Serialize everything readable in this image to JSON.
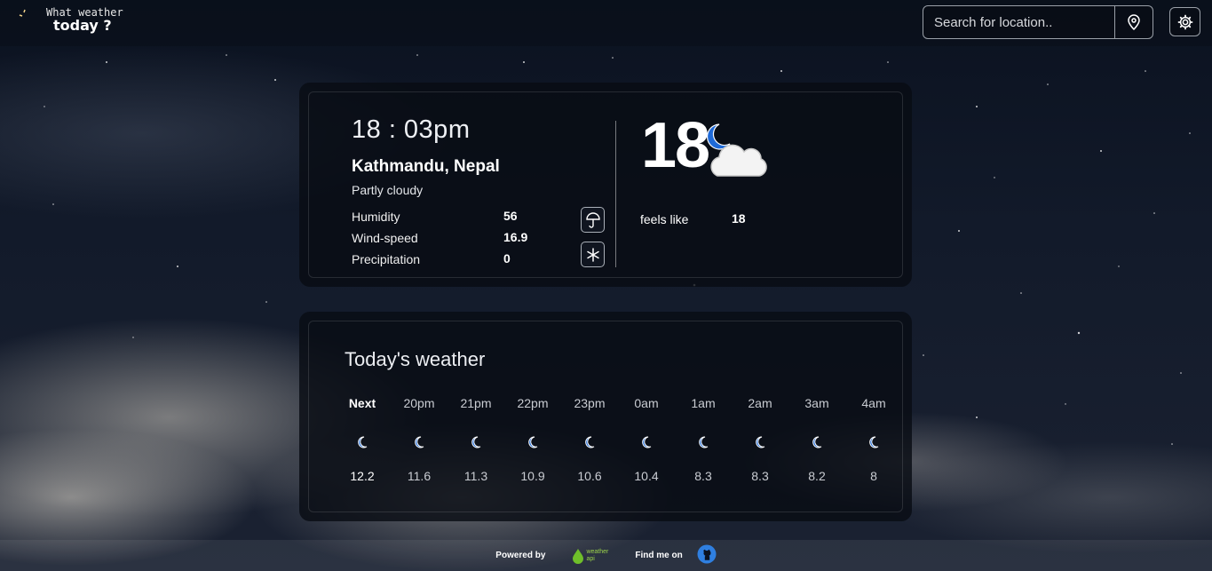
{
  "app": {
    "logo_line1": "What weather",
    "logo_line2": "today ?"
  },
  "search": {
    "placeholder": "Search for location.."
  },
  "current": {
    "time": "18 : 03pm",
    "location": "Kathmandu, Nepal",
    "condition": "Partly cloudy",
    "stats": [
      {
        "label": "Humidity",
        "value": "56"
      },
      {
        "label": "Wind-speed",
        "value": "16.9"
      },
      {
        "label": "Precipitation",
        "value": "0"
      }
    ],
    "temperature": "18",
    "feels_like_label": "feels like",
    "feels_like_value": "18",
    "icon": "moon-cloud-icon"
  },
  "forecast": {
    "title": "Today's weather",
    "hours": [
      {
        "label": "Next",
        "temp": "12.2"
      },
      {
        "label": "20pm",
        "temp": "11.6"
      },
      {
        "label": "21pm",
        "temp": "11.3"
      },
      {
        "label": "22pm",
        "temp": "10.9"
      },
      {
        "label": "23pm",
        "temp": "10.6"
      },
      {
        "label": "0am",
        "temp": "10.4"
      },
      {
        "label": "1am",
        "temp": "8.3"
      },
      {
        "label": "2am",
        "temp": "8.3"
      },
      {
        "label": "3am",
        "temp": "8.2"
      },
      {
        "label": "4am",
        "temp": "8"
      }
    ]
  },
  "footer": {
    "powered_by": "Powered by",
    "find_me": "Find me on",
    "api_line1": "weather",
    "api_line2": "api"
  },
  "colors": {
    "accent_moon": "#1e6ad8",
    "logo_moon": "#f2d38a",
    "api_green": "#6fbf2a"
  }
}
